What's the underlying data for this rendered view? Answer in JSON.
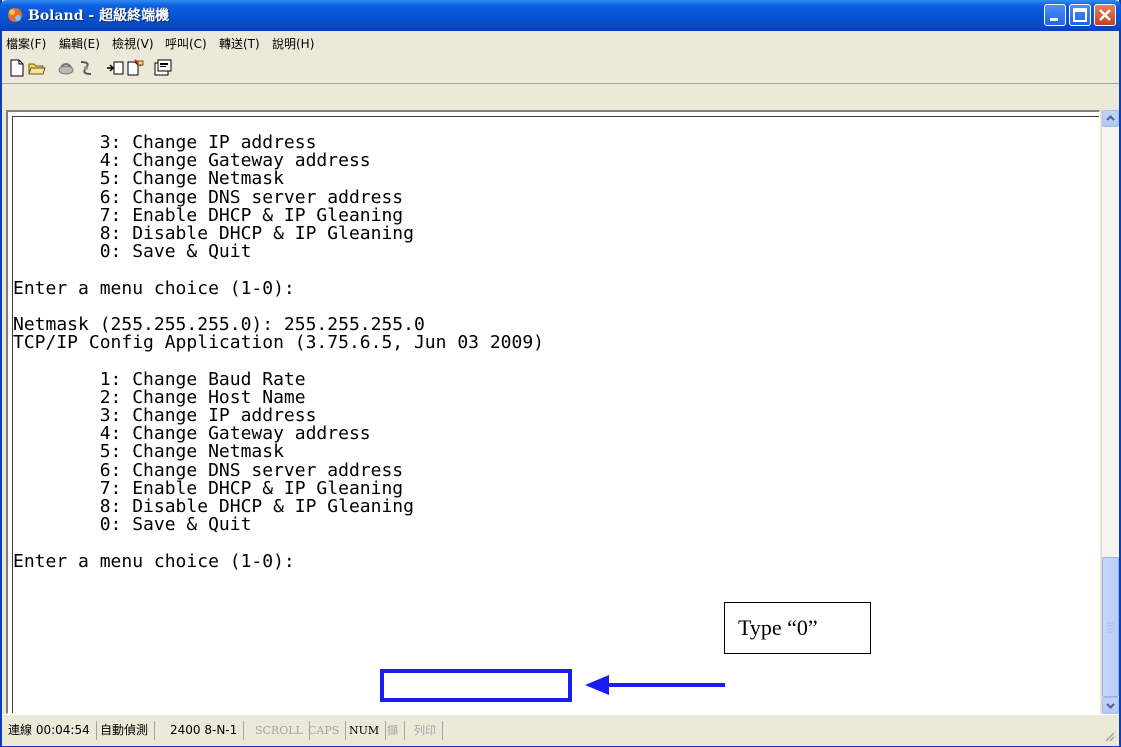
{
  "window": {
    "app_name": "Boland",
    "title_sep": " - ",
    "title_suffix": "超級終端機"
  },
  "menu": {
    "items": [
      "檔案(F)",
      "編輯(E)",
      "檢視(V)",
      "呼叫(C)",
      "轉送(T)",
      "說明(H)"
    ]
  },
  "toolbar": {
    "icons": [
      "new-icon",
      "open-icon",
      "disconnect-icon",
      "connect-icon",
      "send-icon",
      "receive-icon",
      "properties-icon"
    ]
  },
  "terminal": {
    "lines": [
      "        3: Change IP address",
      "        4: Change Gateway address",
      "        5: Change Netmask",
      "        6: Change DNS server address",
      "        7: Enable DHCP & IP Gleaning",
      "        8: Disable DHCP & IP Gleaning",
      "        0: Save & Quit",
      "",
      "Enter a menu choice (1-0):",
      "",
      "Netmask (255.255.255.0): 255.255.255.0",
      "TCP/IP Config Application (3.75.6.5, Jun 03 2009)",
      "",
      "        1: Change Baud Rate",
      "        2: Change Host Name",
      "        3: Change IP address",
      "        4: Change Gateway address",
      "        5: Change Netmask",
      "        6: Change DNS server address",
      "        7: Enable DHCP & IP Gleaning",
      "        8: Disable DHCP & IP Gleaning",
      "        0: Save & Quit",
      "",
      "Enter a menu choice (1-0):"
    ]
  },
  "status": {
    "connection": "連線 00:04:54",
    "detect": "自動偵測",
    "settings": "2400 8-N-1",
    "scroll": "SCROLL",
    "caps": "CAPS",
    "num": "NUM",
    "capture": "擷",
    "print": "列印"
  },
  "annotation": {
    "label": "Type “0”"
  },
  "colors": {
    "titlebar": "#0654d6",
    "annotation": "#1b1bf5"
  }
}
